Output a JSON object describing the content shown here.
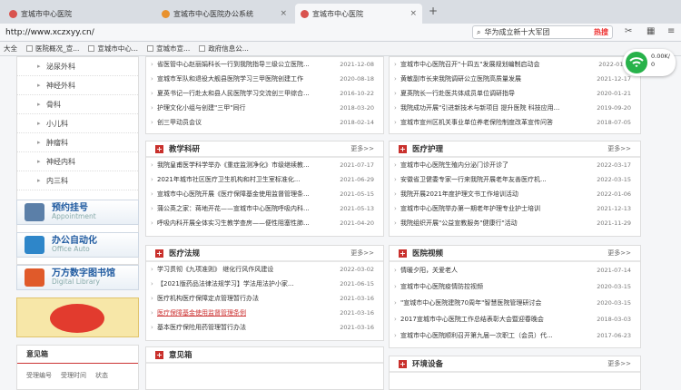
{
  "browser": {
    "tabs": [
      {
        "label": "宣城市中心医院",
        "color": "#d9534f"
      },
      {
        "label": "宣城市中心医院办公系统",
        "color": "#e8912e"
      },
      {
        "label": "宣城市中心医院",
        "color": "#d9534f"
      }
    ],
    "new_tab_label": "+",
    "url": "http://www.xczxyy.cn/",
    "search_text": "华为成立新十大军团",
    "search_badge": "热搜"
  },
  "bookmarks": [
    "大全",
    "医院概况_宣...",
    "宣城市中心...",
    "宣城市宣...",
    "政府信息公..."
  ],
  "sidebar": {
    "items": [
      "泌尿外科",
      "神经外科",
      "骨科",
      "小儿科",
      "肿瘤科",
      "神经内科",
      "内三科"
    ]
  },
  "quick_links": [
    {
      "title": "预约挂号",
      "subtitle": "Appointment",
      "color": "#5b7fa8"
    },
    {
      "title": "办公自动化",
      "subtitle": "Office Auto",
      "color": "#2e86c9"
    },
    {
      "title": "万方数字图书馆",
      "subtitle": "Digital Library",
      "color": "#e05a2a"
    }
  ],
  "feedback": {
    "title": "意见箱",
    "columns": [
      "受理编号",
      "受理时间",
      "状态"
    ]
  },
  "panels": {
    "top_left": {
      "rows": [
        {
          "text": "省医管中心赵丽娟科长一行到我院指导三级公立医院...",
          "date": "2021-12-08"
        },
        {
          "text": "宣城市军队和退役大舰县医院学习三甲医院创建工作",
          "date": "2020-08-18"
        },
        {
          "text": "夏英书记一行赴太和县人民医院学习交流创三甲综合...",
          "date": "2016-10-22"
        },
        {
          "text": "护理文化小组与创建\"三甲\"同行",
          "date": "2018-03-20"
        },
        {
          "text": "创三甲动员会议",
          "date": "2018-02-14"
        }
      ]
    },
    "top_right": {
      "rows": [
        {
          "text": "宣城市中心医院召开\"十四五\"发展规划编制启动会",
          "date": "2022-01-..."
        },
        {
          "text": "黄敏副市长来我院调研公立医院高质量发展",
          "date": "2021-12-17"
        },
        {
          "text": "夏英院长一行赴医共体成员单位调研指导",
          "date": "2020-01-21"
        },
        {
          "text": "我院成功开展\"引进新技术与新项目 提升医院 科技应用...",
          "date": "2019-09-20"
        },
        {
          "text": "宣城市宣州区机关事业单位养老保险制度改革宣传问答",
          "date": "2018-07-05"
        }
      ]
    },
    "teaching": {
      "title": "教学科研",
      "more": "更多>>",
      "rows": [
        {
          "text": "我院皇甫医学科学举办《重症监测净化》市级继续教...",
          "date": "2021-07-17"
        },
        {
          "text": "2021年城市社区医疗卫生机构和村卫生室标准化...",
          "date": "2021-06-29"
        },
        {
          "text": "宣城市中心医院开展《医疗保障基金使用监督管理条...",
          "date": "2021-05-15"
        },
        {
          "text": "蒲公英之家：蒋地开花——宣城市中心医院呼吸内科...",
          "date": "2021-05-13"
        },
        {
          "text": "呼吸内科开展全体实习生教学查房——便性阻塞性肺...",
          "date": "2021-04-20"
        }
      ]
    },
    "nursing": {
      "title": "医疗护理",
      "more": "更多>>",
      "rows": [
        {
          "text": "宣城市中心医院生殖内分泌门诊开诊了",
          "date": "2022-03-17"
        },
        {
          "text": "安徽省卫健委专家一行来我院开展老年友善医疗机...",
          "date": "2022-03-15"
        },
        {
          "text": "我院开展2021年度护理文书工作培训活动",
          "date": "2022-01-06"
        },
        {
          "text": "宣城市中心医院举办第一期老年护理专业护士培训",
          "date": "2021-12-13"
        },
        {
          "text": "我院组织开展\"公益宣教服务\"健康行\"活动",
          "date": "2021-11-29"
        }
      ]
    },
    "law": {
      "title": "医疗法规",
      "more": "更多>>",
      "rows": [
        {
          "text": "学习贯彻《九项准则》 继化行风作风建设",
          "date": "2022-03-02",
          "red": false
        },
        {
          "text": "【2021版药品法律法规学习】学法用法护小家...",
          "date": "2021-06-15",
          "red": false
        },
        {
          "text": "医疗机构医疗保障定点管理暂行办法",
          "date": "2021-03-16",
          "red": false
        },
        {
          "text": "医疗保障基金使用监督管理条例",
          "date": "2021-03-16",
          "red": true
        },
        {
          "text": "基本医疗保险用药管理暂行办法",
          "date": "2021-03-16",
          "red": false
        }
      ]
    },
    "video": {
      "title": "医院视频",
      "more": "更多>>",
      "rows": [
        {
          "text": "情暖夕阳，关爱老人",
          "date": "2021-07-14"
        },
        {
          "text": "宣城市中心医院疫情防控视频",
          "date": "2020-03-15"
        },
        {
          "text": "\"宣城市中心医院建院70周年\"智慧医院管理研讨会",
          "date": "2020-03-15"
        },
        {
          "text": "2017宣城市中心医院工作总结表彰大会暨迎春晚会",
          "date": "2018-03-03"
        },
        {
          "text": "宣城市中心医院顺利召开第九届一次职工（会员）代...",
          "date": "2017-06-23"
        }
      ]
    },
    "feedback_panel": {
      "title": "意见箱"
    },
    "environment": {
      "title": "环境设备",
      "more": "更多>>"
    }
  },
  "wifi_widget": {
    "speed_up": "0.00K/",
    "speed_down": "0"
  }
}
